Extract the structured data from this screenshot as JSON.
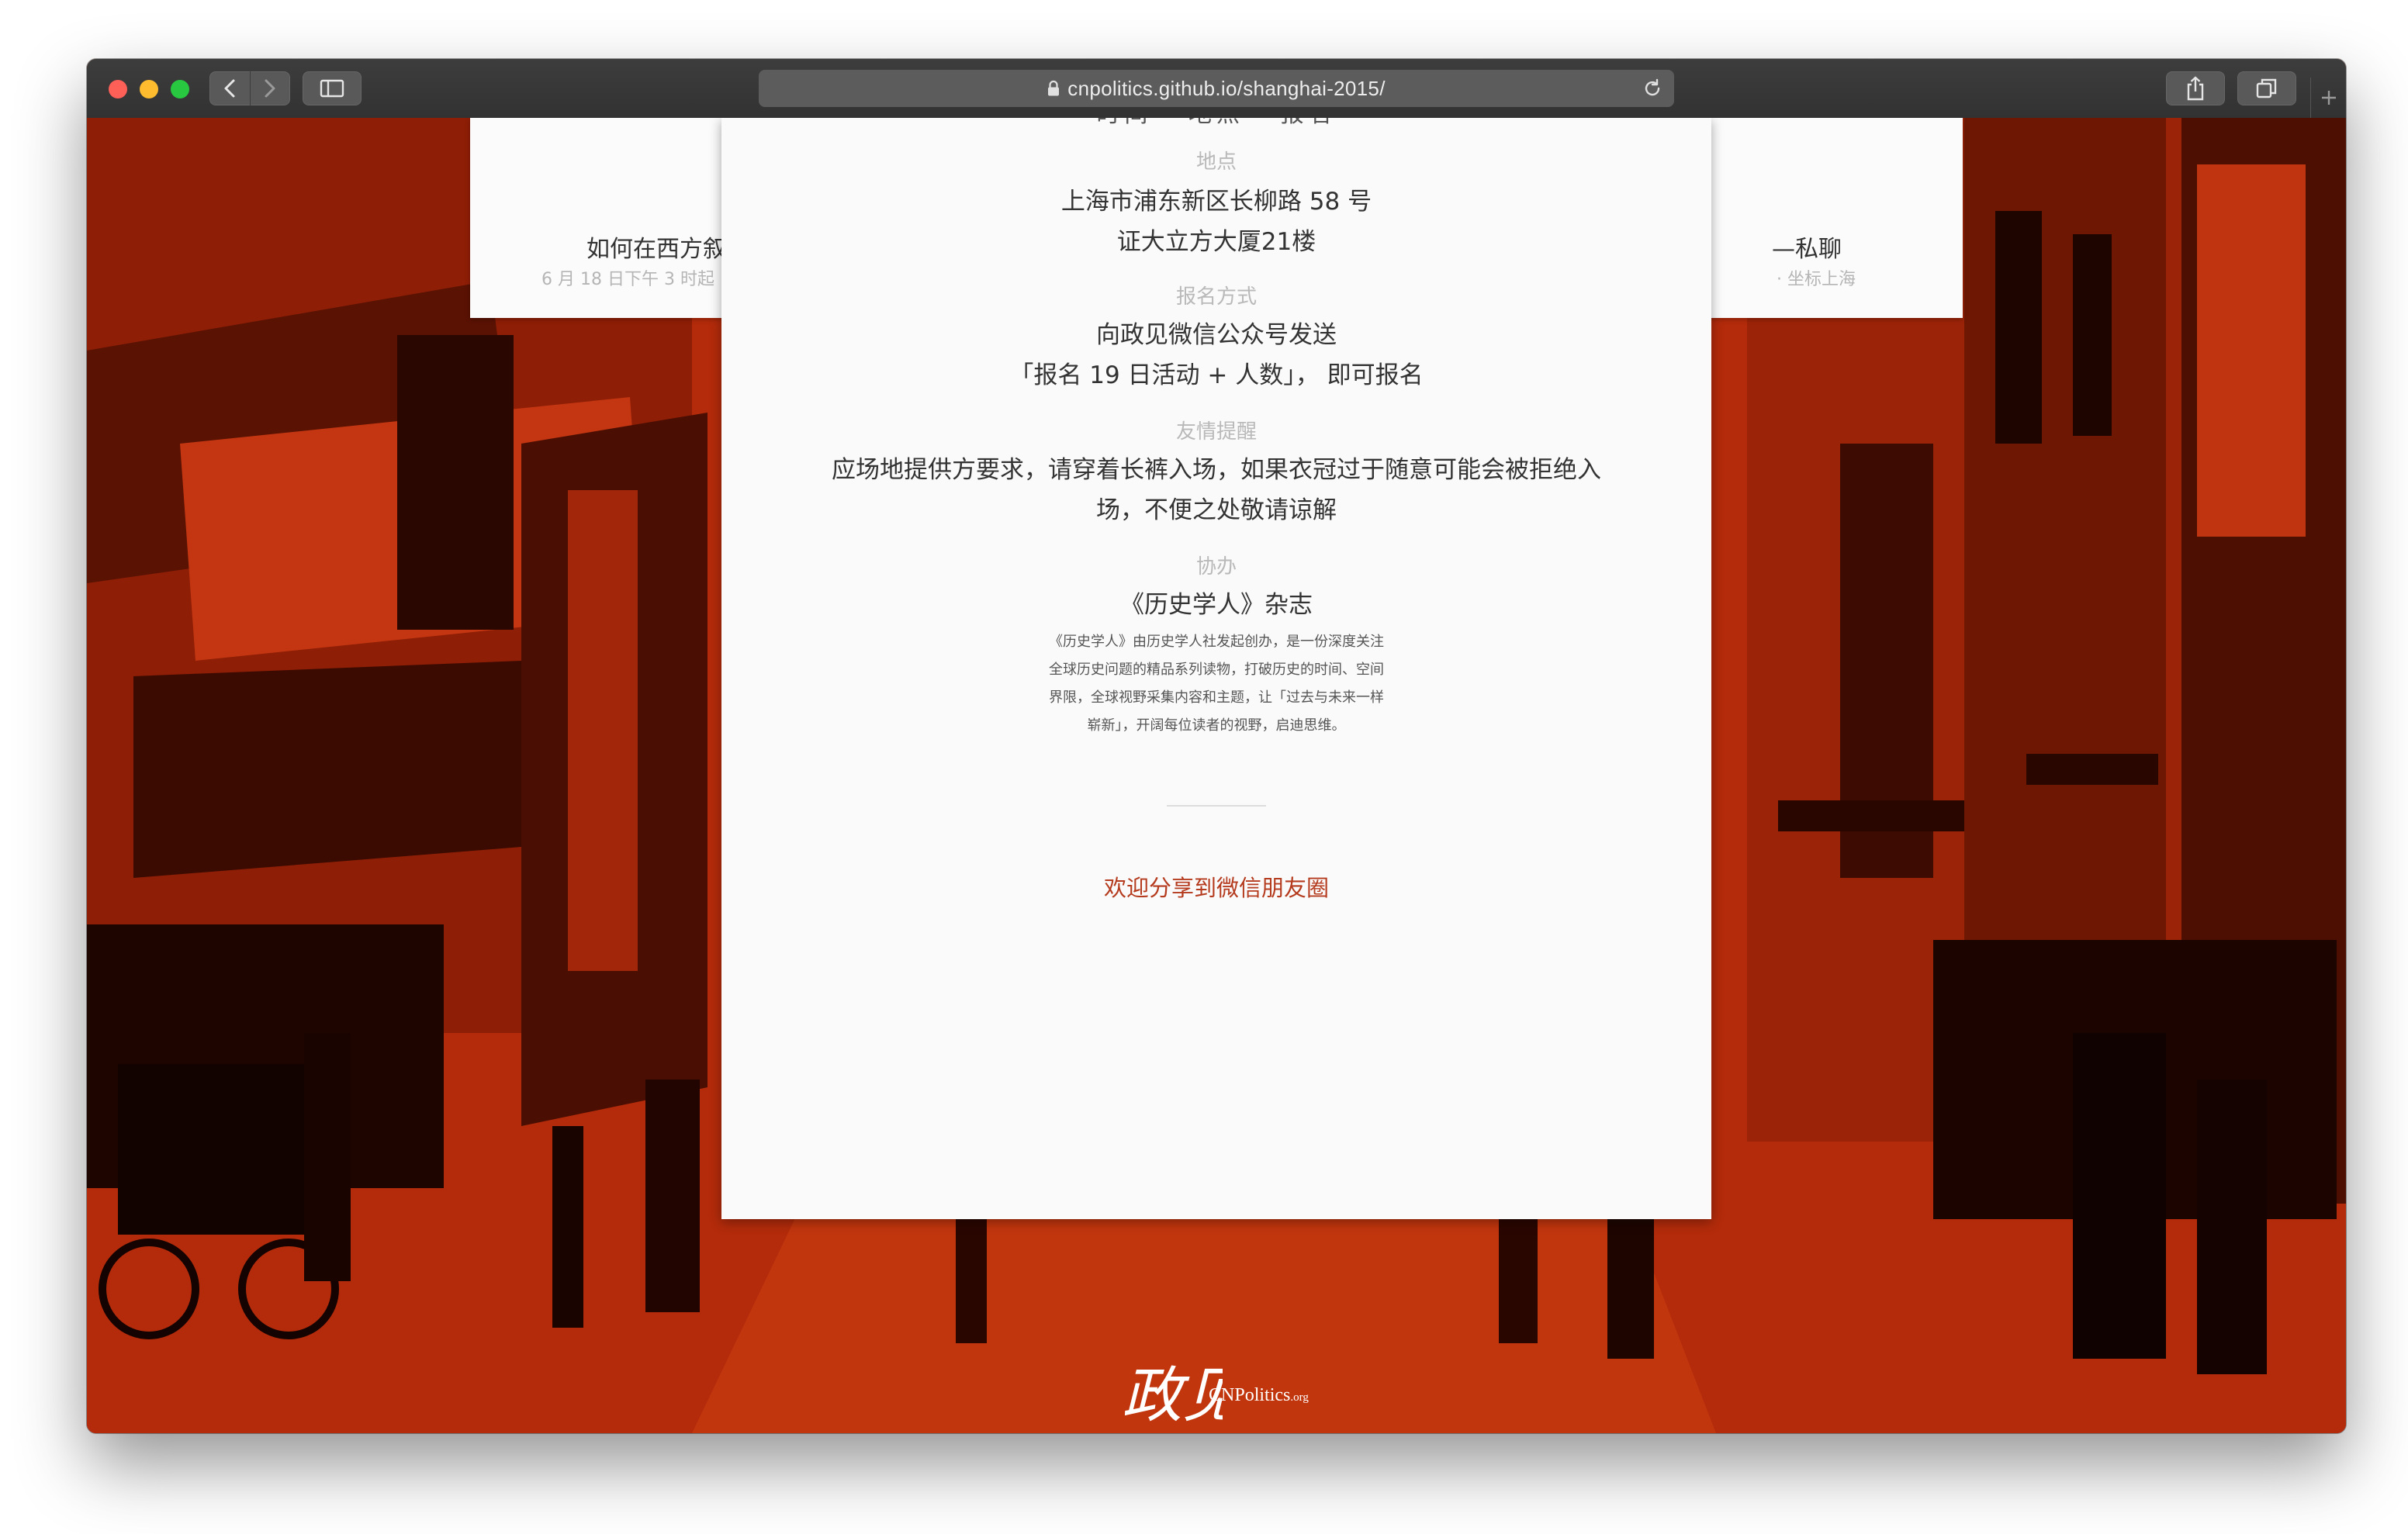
{
  "browser": {
    "url": "cnpolitics.github.io/shanghai-2015/"
  },
  "page": {
    "top_cut": "时间 · 地点 · 报名",
    "left_card": {
      "title": "如何在西方叙述中国",
      "meta": "6 月 18 日下午 3 时起"
    },
    "right_card": {
      "title": "—私聊",
      "meta": "· 坐标上海"
    },
    "location": {
      "label": "地点",
      "line1": "上海市浦东新区长柳路 58 号",
      "line2": "证大立方大厦21楼"
    },
    "signup": {
      "label": "报名方式",
      "line1": "向政见微信公众号发送",
      "line2": "「报名 19 日活动 + 人数」， 即可报名"
    },
    "reminder": {
      "label": "友情提醒",
      "line1": "应场地提供方要求，请穿着长裤入场，如果衣冠过于随意可能会被拒绝入",
      "line2": "场，不便之处敬请谅解"
    },
    "cohost": {
      "label": "协办",
      "name": "《历史学人》杂志",
      "desc_lines": [
        "《历史学人》由历史学人社发起创办，是一份深度关注",
        "全球历史问题的精品系列读物，打破历史的时间、空间",
        "界限，全球视野采集内容和主题，让「过去与未来一样",
        "崭新」，开阔每位读者的视野，启迪思维。"
      ]
    },
    "share_text": "欢迎分享到微信朋友圈",
    "logo": {
      "mark": "政见",
      "brand": "CNPolitics",
      "suffix": ".org"
    }
  },
  "colors": {
    "page_red": "#b32b0b",
    "share_link": "#b53b1e"
  },
  "icons": [
    "back-icon",
    "forward-icon",
    "sidebar-icon",
    "lock-icon",
    "reload-icon",
    "share-icon",
    "tabs-icon",
    "new-tab-icon"
  ]
}
